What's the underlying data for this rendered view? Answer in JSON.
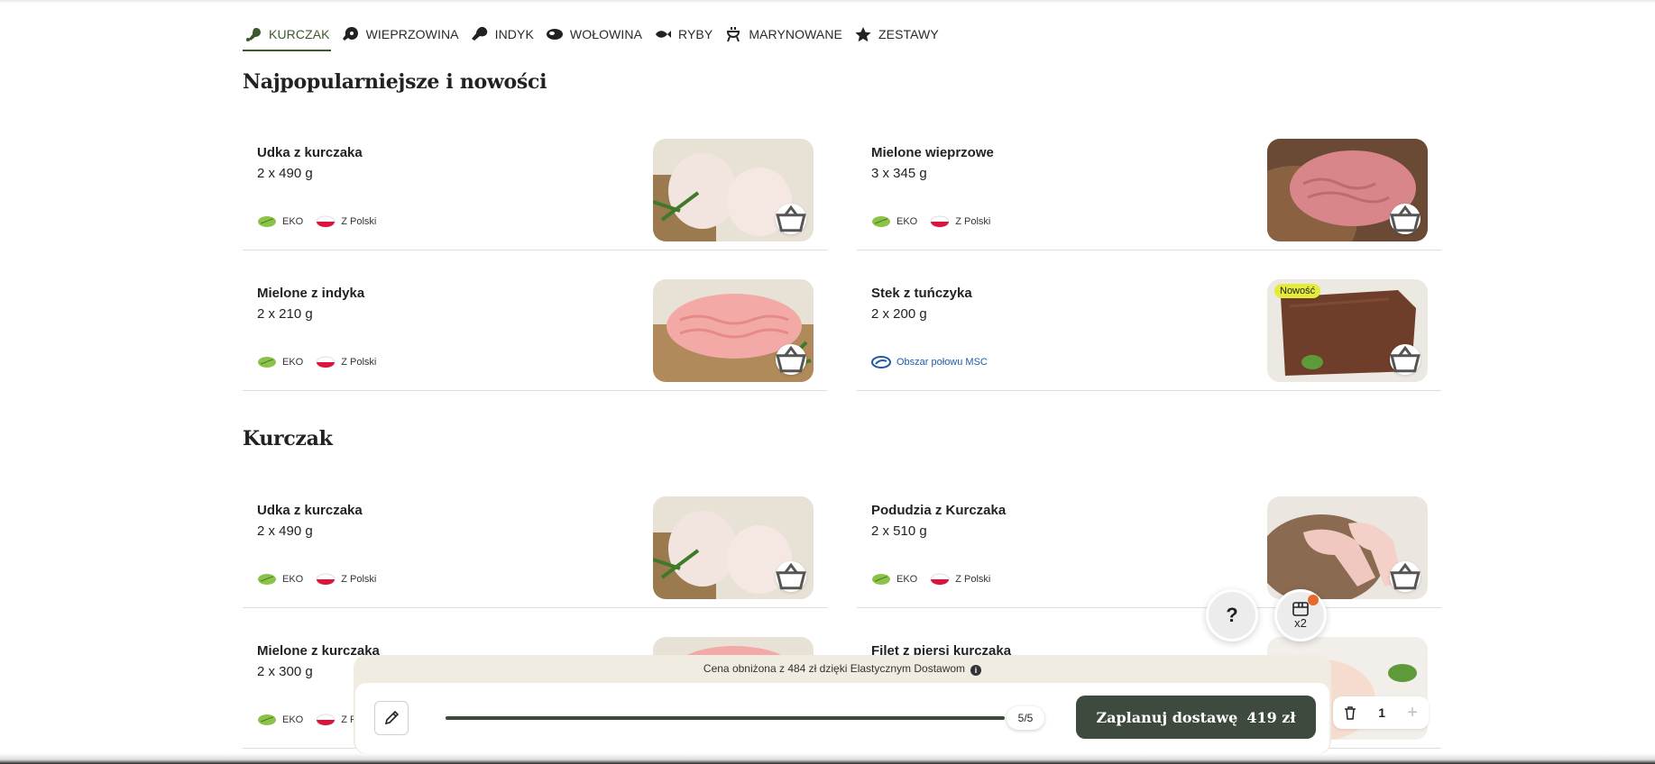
{
  "categories": [
    {
      "label": "KURCZAK",
      "icon": "drumstick-icon",
      "active": true
    },
    {
      "label": "WIEPRZOWINA",
      "icon": "ham-icon",
      "active": false
    },
    {
      "label": "INDYK",
      "icon": "turkey-leg-icon",
      "active": false
    },
    {
      "label": "WOŁOWINA",
      "icon": "steak-icon",
      "active": false
    },
    {
      "label": "RYBY",
      "icon": "fish-icon",
      "active": false
    },
    {
      "label": "MARYNOWANE",
      "icon": "grill-icon",
      "active": false
    },
    {
      "label": "ZESTAWY",
      "icon": "star-icon",
      "active": false
    }
  ],
  "sections": [
    {
      "title": "Najpopularniejsze i nowości",
      "products": [
        {
          "name": "Udka z kurczaka",
          "weight": "2 x 490 g",
          "tags": [
            "EKO",
            "Z Polski"
          ],
          "image": "chicken-thighs-photo"
        },
        {
          "name": "Mielone wieprzowe",
          "weight": "3 x 345 g",
          "tags": [
            "EKO",
            "Z Polski"
          ],
          "image": "minced-pork-photo"
        },
        {
          "name": "Mielone z indyka",
          "weight": "2 x 210 g",
          "tags": [
            "EKO",
            "Z Polski"
          ],
          "image": "minced-turkey-photo"
        },
        {
          "name": "Stek z tuńczyka",
          "weight": "2 x 200 g",
          "tags": [
            "Obszar połowu MSC"
          ],
          "badge": "Nowość",
          "image": "tuna-steak-photo"
        }
      ]
    },
    {
      "title": "Kurczak",
      "products": [
        {
          "name": "Udka z kurczaka",
          "weight": "2 x 490 g",
          "tags": [
            "EKO",
            "Z Polski"
          ],
          "image": "chicken-thighs-photo"
        },
        {
          "name": "Podudzia z Kurczaka",
          "weight": "2 x 510 g",
          "tags": [
            "EKO",
            "Z Polski"
          ],
          "image": "chicken-drumsticks-photo"
        },
        {
          "name": "Mielone z kurczaka",
          "weight": "2 x 300 g",
          "tags": [
            "EKO",
            "Z Polski"
          ],
          "image": "minced-chicken-photo"
        },
        {
          "name": "Filet z piersi kurczaka",
          "weight": "",
          "tags": [],
          "image": "chicken-breast-photo"
        }
      ]
    }
  ],
  "floating": {
    "help_label": "?",
    "box_count": "x2"
  },
  "bottom_bar": {
    "note": "Cena obniżona z 484 zł dzięki Elastycznym Dostawom",
    "progress_text": "5/5",
    "progress_fraction": 1.0,
    "cta_label": "Zaplanuj dostawę",
    "cta_price": "419 zł"
  },
  "quantity": {
    "value": "1",
    "plus": "+"
  },
  "colors": {
    "accent": "#3b5a2c",
    "cta": "#3d4a3d",
    "bar_bg": "#f1ece1",
    "badge_new": "#e3ec3a",
    "notify_dot": "#e46b2b"
  }
}
